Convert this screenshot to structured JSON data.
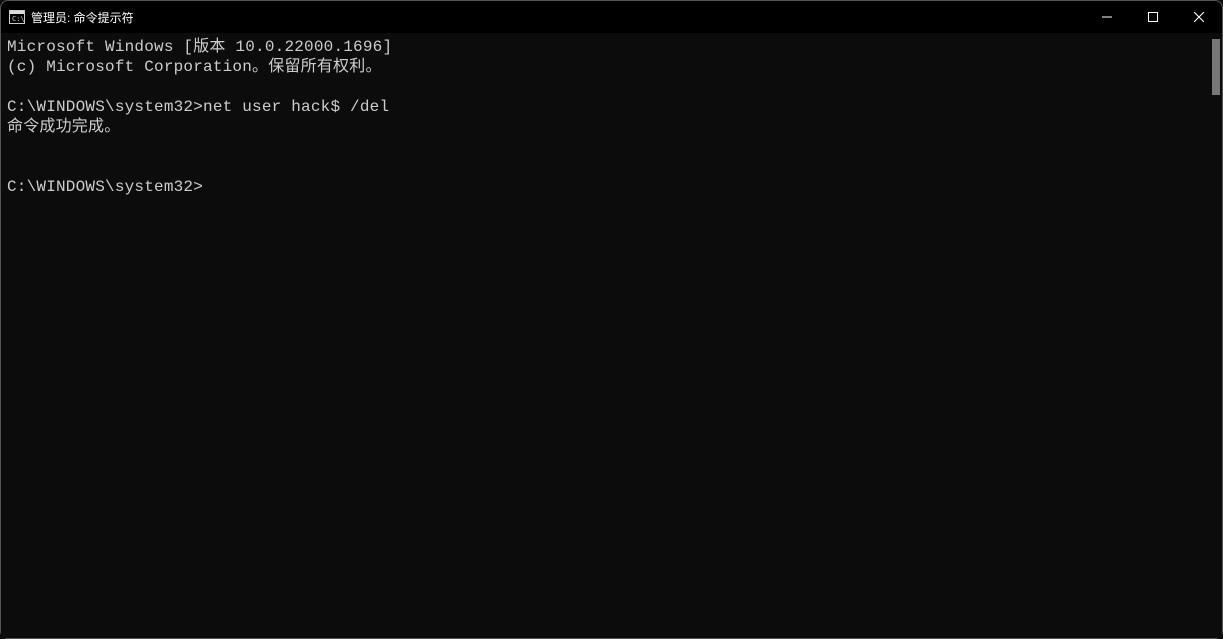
{
  "titlebar": {
    "title": "管理员: 命令提示符"
  },
  "terminal": {
    "banner_line1": "Microsoft Windows [版本 10.0.22000.1696]",
    "banner_line2": "(c) Microsoft Corporation。保留所有权利。",
    "prompt1": "C:\\WINDOWS\\system32>",
    "command1": "net user hack$ /del",
    "output1": "命令成功完成。",
    "prompt2": "C:\\WINDOWS\\system32>"
  }
}
